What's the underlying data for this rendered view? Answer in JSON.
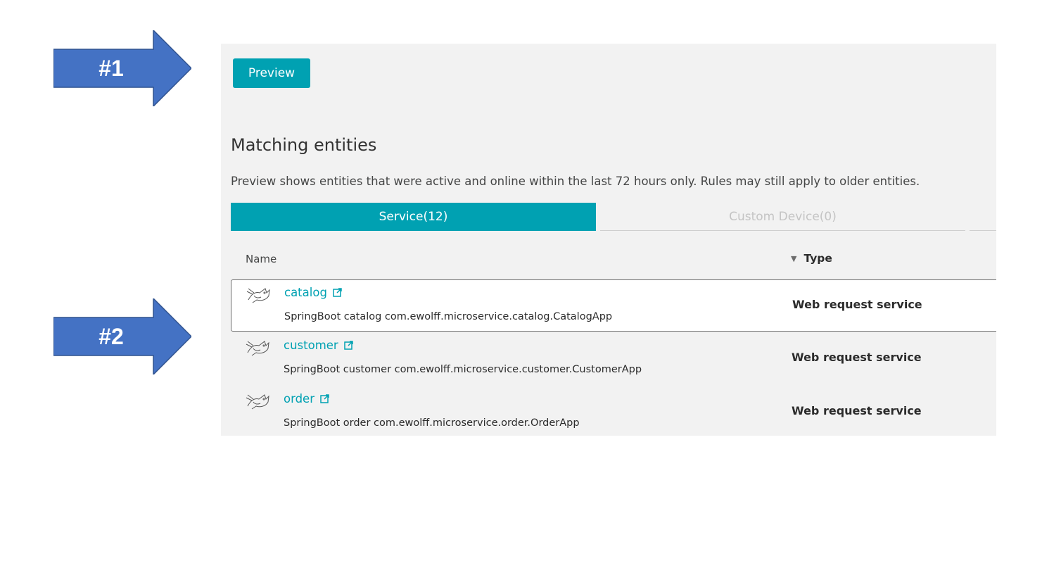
{
  "arrows": [
    {
      "label": "#1",
      "color": "#4472c4"
    },
    {
      "label": "#2",
      "color": "#4472c4"
    }
  ],
  "preview_button": {
    "label": "Preview",
    "color": "#00a1b2"
  },
  "section": {
    "title": "Matching entities",
    "description": "Preview shows entities that were active and online within the last 72 hours only. Rules may still apply to older entities."
  },
  "tabs": [
    {
      "label": "Service(12)",
      "active": true
    },
    {
      "label": "Custom Device(0)",
      "active": false
    }
  ],
  "table": {
    "columns": {
      "name": "Name",
      "type": "Type"
    },
    "sort_icon": "triangle-down-icon",
    "rows": [
      {
        "name": "catalog",
        "description": "SpringBoot catalog com.ewolff.microservice.catalog.CatalogApp",
        "type": "Web request service",
        "icon": "tomcat-icon",
        "selected": true
      },
      {
        "name": "customer",
        "description": "SpringBoot customer com.ewolff.microservice.customer.CustomerApp",
        "type": "Web request service",
        "icon": "tomcat-icon",
        "selected": false
      },
      {
        "name": "order",
        "description": "SpringBoot order com.ewolff.microservice.order.OrderApp",
        "type": "Web request service",
        "icon": "tomcat-icon",
        "selected": false
      }
    ]
  }
}
